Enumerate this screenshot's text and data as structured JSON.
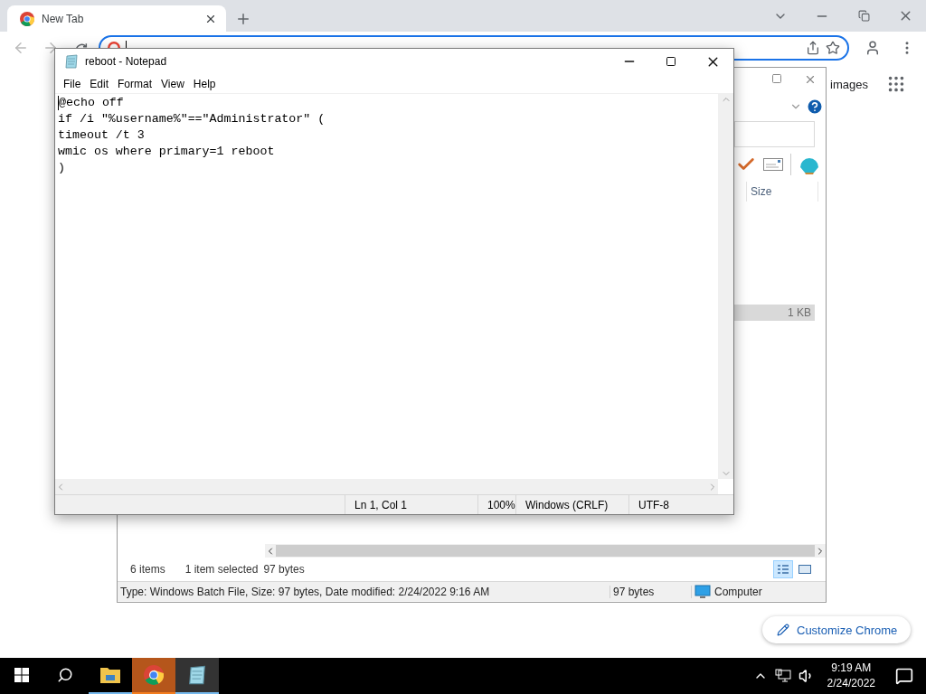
{
  "browser": {
    "tabs": [
      {
        "title": "New Tab",
        "selected": true
      }
    ],
    "images_link": "images",
    "customize_button": "Customize Chrome"
  },
  "explorer": {
    "column_header": "Size",
    "selected_row": {
      "size": "1 KB",
      "selected": true
    },
    "status": {
      "items": "6 items",
      "selection": "1 item selected",
      "selection_size": "97 bytes"
    },
    "details_bar": {
      "info": "Type: Windows Batch File, Size: 97 bytes, Date modified: 2/24/2022 9:16 AM",
      "size": "97 bytes",
      "zone": "Computer"
    }
  },
  "notepad": {
    "title": "reboot - Notepad",
    "menu": [
      "File",
      "Edit",
      "Format",
      "View",
      "Help"
    ],
    "lines": [
      "@echo off",
      "if /i \"%username%\"==\"Administrator\" (",
      "timeout /t 3",
      "wmic os where primary=1 reboot",
      ")"
    ],
    "status": [
      "Ln 1, Col 1",
      "100%",
      "Windows (CRLF)",
      "UTF-8"
    ]
  },
  "taskbar": {
    "apps": [
      {
        "kind": "explorer",
        "active": false,
        "flashing": false
      },
      {
        "kind": "chrome",
        "active": false,
        "flashing": true
      },
      {
        "kind": "notepad",
        "active": true,
        "flashing": false
      }
    ],
    "time": "9:19 AM",
    "date": "2/24/2022"
  }
}
